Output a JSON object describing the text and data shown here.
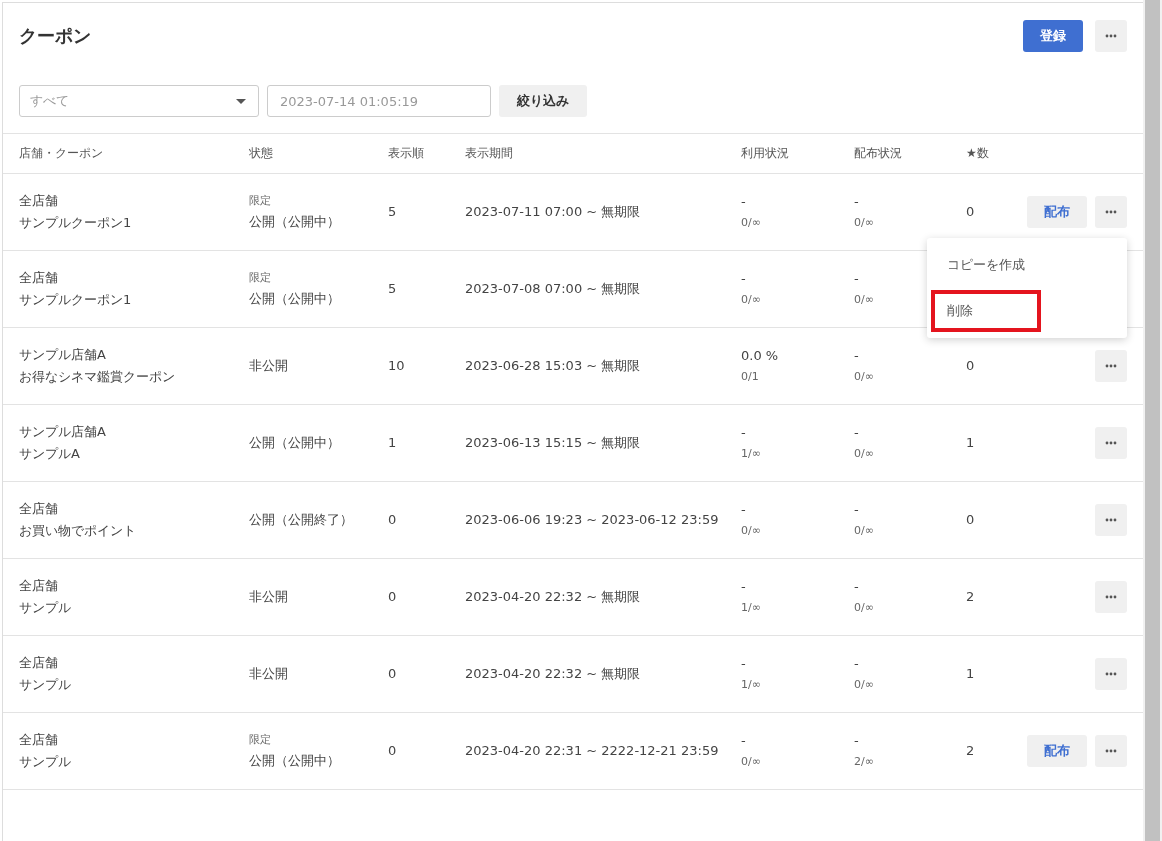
{
  "header": {
    "title": "クーポン",
    "buttons": [
      {
        "kind": "primary",
        "label": "登録"
      },
      {
        "kind": "more"
      }
    ]
  },
  "filters": {
    "select": {
      "value": "すべて"
    },
    "date": {
      "placeholder": "2023-07-14 01:05:19"
    },
    "button": "絞り込み"
  },
  "table": {
    "columns": [
      "店舗・クーポン",
      "状態",
      "表示順",
      "表示期間",
      "利用状況",
      "配布状況",
      "★数"
    ],
    "rows": [
      {
        "store": "全店舗",
        "coupon": "サンプルクーポン1",
        "badge": "限定",
        "status": "公開（公開中）",
        "order": "5",
        "period": "2023-07-11 07:00 ~ 無期限",
        "usage_rate": "-",
        "usage_count": "0/∞",
        "distribution_rate": "-",
        "distribution_count": "0/∞",
        "star_count": "0",
        "actions": [
          {
            "kind": "distribute",
            "label": "配布"
          },
          {
            "kind": "more"
          }
        ],
        "menu": {
          "items": [
            {
              "label": "コピーを作成",
              "highlighted": false
            },
            {
              "label": "削除",
              "highlighted": true
            }
          ]
        }
      },
      {
        "store": "全店舗",
        "coupon": "サンプルクーポン1",
        "badge": "限定",
        "status": "公開（公開中）",
        "order": "5",
        "period": "2023-07-08 07:00 ~ 無期限",
        "usage_rate": "-",
        "usage_count": "0/∞",
        "distribution_rate": "-",
        "distribution_count": "0/∞"
      },
      {
        "store": "サンプル店舗A",
        "coupon": "お得なシネマ鑑賞クーポン",
        "status": "非公開",
        "order": "10",
        "period": "2023-06-28 15:03 ~ 無期限",
        "usage_rate": "0.0 %",
        "usage_count": "0/1",
        "distribution_rate": "-",
        "distribution_count": "0/∞",
        "star_count": "0",
        "actions": [
          {
            "kind": "more"
          }
        ]
      },
      {
        "store": "サンプル店舗A",
        "coupon": "サンプルA",
        "status": "公開（公開中）",
        "order": "1",
        "period": "2023-06-13 15:15 ~ 無期限",
        "usage_rate": "-",
        "usage_count": "1/∞",
        "distribution_rate": "-",
        "distribution_count": "0/∞",
        "star_count": "1",
        "actions": [
          {
            "kind": "more"
          }
        ]
      },
      {
        "store": "全店舗",
        "coupon": "お買い物でポイント",
        "status": "公開（公開終了）",
        "order": "0",
        "period": "2023-06-06 19:23 ~ 2023-06-12 23:59",
        "usage_rate": "-",
        "usage_count": "0/∞",
        "distribution_rate": "-",
        "distribution_count": "0/∞",
        "star_count": "0",
        "actions": [
          {
            "kind": "more"
          }
        ]
      },
      {
        "store": "全店舗",
        "coupon": "サンプル",
        "status": "非公開",
        "order": "0",
        "period": "2023-04-20 22:32 ~ 無期限",
        "usage_rate": "-",
        "usage_count": "1/∞",
        "distribution_rate": "-",
        "distribution_count": "0/∞",
        "star_count": "2",
        "actions": [
          {
            "kind": "more"
          }
        ]
      },
      {
        "store": "全店舗",
        "coupon": "サンプル",
        "status": "非公開",
        "order": "0",
        "period": "2023-04-20 22:32 ~ 無期限",
        "usage_rate": "-",
        "usage_count": "1/∞",
        "distribution_rate": "-",
        "distribution_count": "0/∞",
        "star_count": "1",
        "actions": [
          {
            "kind": "more"
          }
        ]
      },
      {
        "store": "全店舗",
        "coupon": "サンプル",
        "badge": "限定",
        "status": "公開（公開中）",
        "order": "0",
        "period": "2023-04-20 22:31 ~ 2222-12-21 23:59",
        "usage_rate": "-",
        "usage_count": "0/∞",
        "distribution_rate": "-",
        "distribution_count": "2/∞",
        "star_count": "2",
        "actions": [
          {
            "kind": "distribute",
            "label": "配布"
          },
          {
            "kind": "more"
          }
        ]
      }
    ]
  }
}
